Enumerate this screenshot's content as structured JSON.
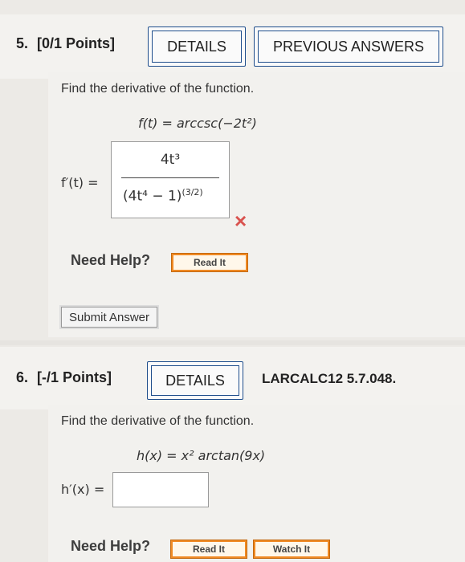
{
  "q5": {
    "number": "5.",
    "points": "[0/1 Points]",
    "details_label": "DETAILS",
    "prev_answers_label": "PREVIOUS ANSWERS",
    "prompt": "Find the derivative of the function.",
    "function_text": "f(t) = arccsc(−2t²)",
    "answer_label": "f′(t) =",
    "answer_numerator": "4t³",
    "answer_denominator": "(4t⁴ − 1)",
    "answer_exponent": "(3/2)",
    "result_mark": "×",
    "need_help": "Need Help?",
    "read_it": "Read It",
    "submit": "Submit Answer"
  },
  "q6": {
    "number": "6.",
    "points": "[-/1 Points]",
    "details_label": "DETAILS",
    "source": "LARCALC12 5.7.048.",
    "prompt": "Find the derivative of the function.",
    "function_text": "h(x) = x² arctan(9x)",
    "answer_label": "h′(x) =",
    "answer_value": "",
    "need_help": "Need Help?",
    "read_it": "Read It",
    "watch_it": "Watch It"
  },
  "colors": {
    "accent": "#1f4e8c",
    "error": "#d9534f",
    "help_button": "#f08a24"
  }
}
